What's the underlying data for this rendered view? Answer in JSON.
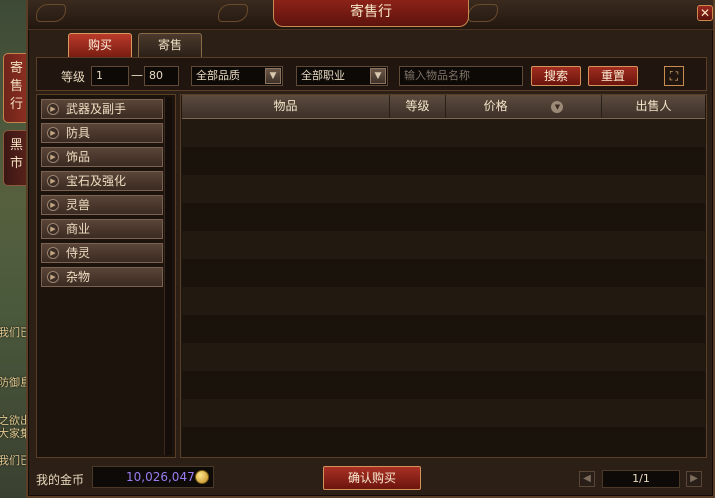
{
  "window": {
    "title": "寄售行",
    "close_label": "✕"
  },
  "tabs": [
    {
      "label": "购买"
    },
    {
      "label": "寄售"
    }
  ],
  "side_tabs": [
    {
      "label": "寄售行"
    },
    {
      "label": "黑市"
    }
  ],
  "background_text": [
    "我们已",
    "防御島",
    "之欲出",
    "大家集",
    "我们已"
  ],
  "filters": {
    "level_label": "等级",
    "level_min": "1",
    "level_sep": "—",
    "level_max": "80",
    "quality": "全部品质",
    "profession": "全部职业",
    "search_placeholder": "输入物品名称",
    "search_button": "搜索",
    "reset_button": "重置"
  },
  "categories": [
    {
      "label": "武器及副手"
    },
    {
      "label": "防具"
    },
    {
      "label": "饰品"
    },
    {
      "label": "宝石及强化"
    },
    {
      "label": "灵兽"
    },
    {
      "label": "商业"
    },
    {
      "label": "侍灵"
    },
    {
      "label": "杂物"
    }
  ],
  "table": {
    "columns": [
      {
        "label": "物品"
      },
      {
        "label": "等级"
      },
      {
        "label": "价格"
      },
      {
        "label": "出售人"
      }
    ],
    "rows": []
  },
  "bottom": {
    "gold_label": "我的金币",
    "gold_value": "10,026,047",
    "confirm_button": "确认购买",
    "page": "1/1"
  },
  "colors": {
    "accent_red": "#8c2218",
    "gold_text": "#9a7cf0",
    "panel_bg": "#2b1f16"
  }
}
